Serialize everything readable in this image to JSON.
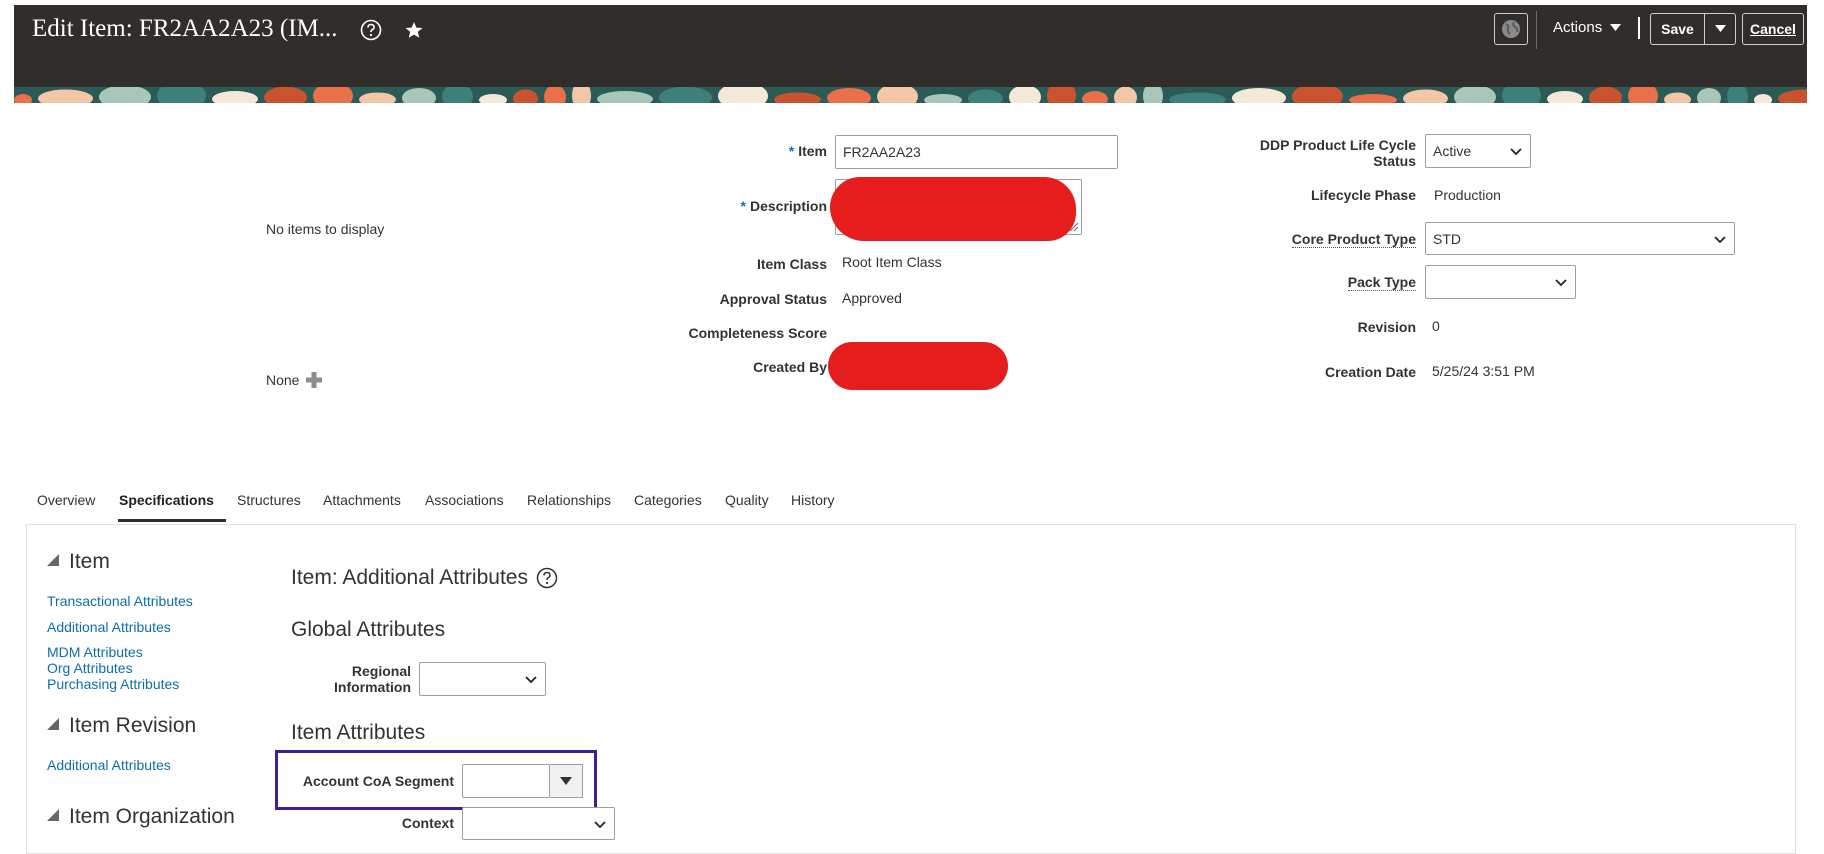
{
  "header": {
    "title": "Edit Item: FR2AA2A23 (IM...",
    "actions_label": "Actions",
    "save_label": "Save",
    "cancel_label": "Cancel"
  },
  "form": {
    "left_empty_text": "No items to display",
    "none_label": "None",
    "item_label": "Item",
    "item_value": "FR2AA2A23",
    "required_mark": "*",
    "description_label": "Description",
    "item_class_label": "Item Class",
    "item_class_value": "Root Item Class",
    "approval_status_label": "Approval Status",
    "approval_status_value": "Approved",
    "completeness_label": "Completeness Score",
    "created_by_label": "Created By",
    "ddp_label_line1": "DDP Product Life Cycle",
    "ddp_label_line2": "Status",
    "ddp_value": "Active",
    "lifecycle_label": "Lifecycle Phase",
    "lifecycle_value": "Production",
    "core_type_label": "Core Product Type",
    "core_type_value": "STD",
    "pack_type_label": "Pack Type",
    "pack_type_value": "",
    "revision_label": "Revision",
    "revision_value": "0",
    "creation_date_label": "Creation Date",
    "creation_date_value": "5/25/24 3:51 PM"
  },
  "tabs": [
    "Overview",
    "Specifications",
    "Structures",
    "Attachments",
    "Associations",
    "Relationships",
    "Categories",
    "Quality",
    "History"
  ],
  "active_tab": "Specifications",
  "nav": {
    "item_heading": "Item",
    "item_links": [
      "Transactional Attributes",
      "Additional Attributes",
      "MDM Attributes",
      "Org Attributes",
      "Purchasing Attributes"
    ],
    "revision_heading": "Item Revision",
    "revision_links": [
      "Additional Attributes"
    ],
    "org_heading": "Item Organization"
  },
  "content": {
    "title": "Item: Additional Attributes",
    "global_heading": "Global Attributes",
    "regional_label_line1": "Regional",
    "regional_label_line2": "Information",
    "item_attr_heading": "Item Attributes",
    "account_label": "Account CoA Segment",
    "context_label": "Context"
  },
  "colors": {
    "header_bg": "#312d2a",
    "link": "#0e6eac",
    "required": "#0572ce",
    "highlight_box": "#3f1e9c",
    "redaction": "#e51d1d"
  }
}
